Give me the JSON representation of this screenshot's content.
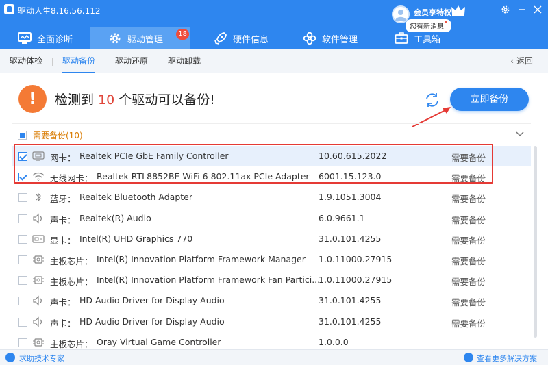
{
  "app": {
    "title": "驱动人生8.16.56.112"
  },
  "nav": [
    {
      "label": "全面诊断",
      "icon": "monitor-icon"
    },
    {
      "label": "驱动管理",
      "icon": "gear-icon",
      "badge": "18"
    },
    {
      "label": "硬件信息",
      "icon": "rocket-icon"
    },
    {
      "label": "软件管理",
      "icon": "grid-flower-icon"
    },
    {
      "label": "工具箱",
      "icon": "toolbox-icon"
    }
  ],
  "user": {
    "vip": "会员享特权",
    "message": "您有新消息"
  },
  "subtabs": [
    "驱动体检",
    "驱动备份",
    "驱动还原",
    "驱动卸载"
  ],
  "back_label": "返回",
  "headline": {
    "prefix": "检测到",
    "count": "10",
    "suffix": "个驱动可以备份!"
  },
  "backup_button": "立即备份",
  "group": {
    "label": "需要备份(10)"
  },
  "devices": [
    {
      "type": "网卡：",
      "name": "Realtek PCIe GbE Family Controller",
      "version": "10.60.615.2022",
      "status": "需要备份",
      "checked": true,
      "icon": "network-card-icon"
    },
    {
      "type": "无线网卡：",
      "name": "Realtek RTL8852BE WiFi 6 802.11ax PCIe Adapter",
      "version": "6001.15.123.0",
      "status": "需要备份",
      "checked": true,
      "icon": "wifi-icon"
    },
    {
      "type": "蓝牙：",
      "name": "Realtek Bluetooth Adapter",
      "version": "1.9.1051.3004",
      "status": "需要备份",
      "checked": false,
      "icon": "bluetooth-icon"
    },
    {
      "type": "声卡：",
      "name": "Realtek(R) Audio",
      "version": "6.0.9661.1",
      "status": "需要备份",
      "checked": false,
      "icon": "speaker-icon"
    },
    {
      "type": "显卡：",
      "name": "Intel(R) UHD Graphics 770",
      "version": "31.0.101.4255",
      "status": "需要备份",
      "checked": false,
      "icon": "graphics-card-icon"
    },
    {
      "type": "主板芯片：",
      "name": "Intel(R) Innovation Platform Framework Manager",
      "version": "1.0.11000.27915",
      "status": "需要备份",
      "checked": false,
      "icon": "chip-icon"
    },
    {
      "type": "主板芯片：",
      "name": "Intel(R) Innovation Platform Framework Fan Partici...",
      "version": "1.0.11000.27915",
      "status": "需要备份",
      "checked": false,
      "icon": "chip-icon"
    },
    {
      "type": "声卡：",
      "name": "HD Audio Driver for Display Audio",
      "version": "31.0.101.4255",
      "status": "需要备份",
      "checked": false,
      "icon": "speaker-icon"
    },
    {
      "type": "声卡：",
      "name": "HD Audio Driver for Display Audio",
      "version": "31.0.101.4255",
      "status": "需要备份",
      "checked": false,
      "icon": "speaker-icon"
    },
    {
      "type": "主板芯片：",
      "name": "Oray Virtual Game Controller",
      "version": "1.0.0.0",
      "status": "",
      "checked": false,
      "icon": "chip-icon"
    }
  ],
  "footer": {
    "left": "求助技术专家",
    "right": "查看更多解决方案"
  }
}
